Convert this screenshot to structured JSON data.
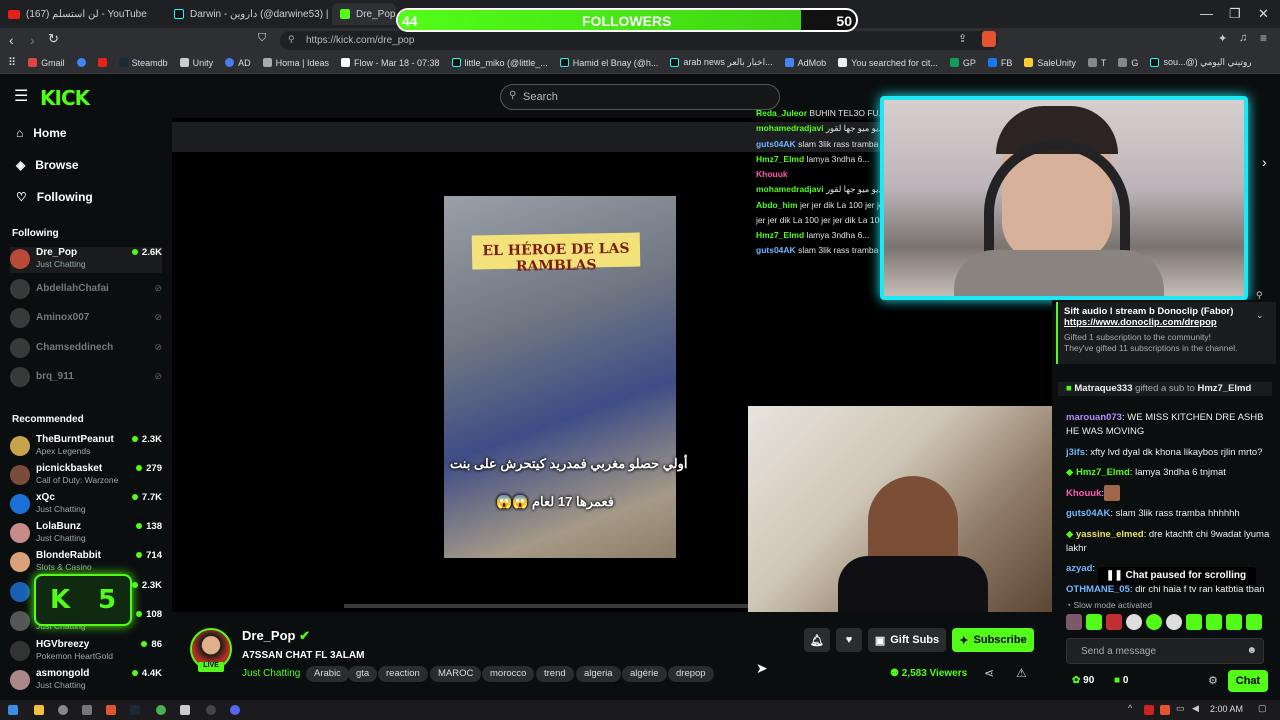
{
  "browser": {
    "tabs": [
      {
        "title": "(167) ‎لن استسلم‎ - YouTube",
        "icon": "youtube-icon"
      },
      {
        "title": "Darwin - ‎داروين (@darwine53) | TikTok",
        "icon": "tiktok-icon"
      },
      {
        "title": "Dre_Pop",
        "icon": "kick-icon"
      }
    ],
    "url": "https://kick.com/dre_pop",
    "bookmarks": [
      "Gmail",
      "Steamdb",
      "Unity",
      "AD",
      "Homa | Ideas",
      "Flow - Mar 18 - 07:38",
      "little_miko (@little_...",
      "Hamid el Bnay (@h...",
      "arab news ‎اخبار بالعر...",
      "AdMob",
      "You searched for cit...",
      "GP",
      "FB",
      "SaleUnity",
      "T",
      "G",
      "sou...@) ‎روتيني اليومي"
    ]
  },
  "kick": {
    "logo": "KICK",
    "search_placeholder": "Search",
    "nav": [
      {
        "label": "Home",
        "icon": "home-icon"
      },
      {
        "label": "Browse",
        "icon": "compass-icon"
      },
      {
        "label": "Following",
        "icon": "heart-icon"
      }
    ],
    "following_header": "Following",
    "following": [
      {
        "name": "Dre_Pop",
        "sub": "Just Chatting",
        "viewers": "2.6K",
        "live": true
      },
      {
        "name": "AbdellahChafai",
        "live": false
      },
      {
        "name": "Aminox007",
        "live": false
      },
      {
        "name": "Chamseddinech",
        "live": false
      },
      {
        "name": "brq_911",
        "live": false
      }
    ],
    "recommended_header": "Recommended",
    "recommended": [
      {
        "name": "TheBurntPeanut",
        "sub": "Apex Legends",
        "viewers": "2.3K"
      },
      {
        "name": "picnickbasket",
        "sub": "Call of Duty: Warzone",
        "viewers": "279"
      },
      {
        "name": "xQc",
        "sub": "Just Chatting",
        "viewers": "7.7K"
      },
      {
        "name": "LolaBunz",
        "sub": "Just Chatting",
        "viewers": "138"
      },
      {
        "name": "BlondeRabbit",
        "sub": "Slots & Casino",
        "viewers": "714"
      },
      {
        "name": "",
        "sub": "",
        "viewers": "2.3K"
      },
      {
        "name": "",
        "sub": "Just Chatting",
        "viewers": "108"
      },
      {
        "name": "HGVbreezy",
        "sub": "Pokemon HeartGold",
        "viewers": "86"
      },
      {
        "name": "asmongold",
        "sub": "Just Chatting",
        "viewers": "4.4K"
      }
    ]
  },
  "overlay": {
    "followers_label": "FOLLOWERS",
    "followers_current": "44",
    "followers_goal": "50",
    "followers_progress": 0.88,
    "k_badge_letter": "K",
    "k_badge_count": "5"
  },
  "video": {
    "banner": "EL HÉROE DE LAS RAMBLAS",
    "caption_1": "أولي حصلو مغربي فمدريد كيتحرش على بنت",
    "caption_2": "😱😱 فعمرها 17 لعام",
    "overlay_chat": [
      {
        "user": "Reda_Juleor",
        "text": "BUHIN TEL3O FU..."
      },
      {
        "user": "mohamedradjavi",
        "text": "‎ديو ميو جها لقور‎"
      },
      {
        "user": "guts04AK",
        "text": "slam 3lik rass tramba"
      },
      {
        "user": "Hmz7_Elmd",
        "text": "lamya 3ndha 6..."
      },
      {
        "user": "Khouuk",
        "text": ""
      },
      {
        "user": "mohamedradjavi",
        "text": "‎ديو ميو جها لقور‎"
      },
      {
        "user": "Abdo_him",
        "text": "jer jer dik La 100 jer jer"
      },
      {
        "user": "",
        "text": "jer jer dik La 100 jer jer dik La 100"
      },
      {
        "user": "Hmz7_Elmd",
        "text": "lamya 3ndha 6..."
      },
      {
        "user": "guts04AK",
        "text": "slam 3lik rass tramba"
      }
    ]
  },
  "stream": {
    "streamer": "Dre_Pop",
    "title": "A7SSAN CHAT FL 3ALAM",
    "category": "Just Chatting",
    "live_label": "LIVE",
    "tags": [
      "Arabic",
      "gta",
      "reaction",
      "MAROC",
      "morocco",
      "trend",
      "algeria",
      "algérie",
      "drepop"
    ],
    "gift_label": "Gift Subs",
    "subscribe_label": "Subscribe",
    "viewers": "2,583 Viewers"
  },
  "chat": {
    "pinned_title": "Sift audio l stream b Donoclip (Fabor)",
    "pinned_link": "https://www.donoclip.com/drepop",
    "gift_note_1": "Gifted 1 subscription to the community!",
    "gift_note_2": "They've gifted 11 subscriptions in the channel.",
    "gift_event": {
      "from": "Matraque333",
      "mid": "gifted a sub to",
      "to": "Hmz7_Elmd"
    },
    "messages": [
      {
        "user": "marouan073",
        "text": "WE MISS KITCHEN DRE ASHB HE WAS MOVING",
        "color": "#b58cff"
      },
      {
        "user": "j3ifs",
        "text": "xfty lvd dyal dk khona likaybos rjlin mrto?",
        "color": "#6fb6ff"
      },
      {
        "user": "Hmz7_Elmd",
        "text": "lamya 3ndha 6 tnjmat",
        "color": "#53fc18"
      },
      {
        "user": "Khouuk",
        "text": "",
        "color": "#ff5bb0"
      },
      {
        "user": "guts04AK",
        "text": "slam 3lik rass tramba hhhhhh",
        "color": "#6fb6ff"
      },
      {
        "user": "yassine_elmed",
        "text": "dre ktachft chi 9wadat lyuma lakhr",
        "color": "#e8e35a"
      },
      {
        "user": "azyad",
        "text": "",
        "color": "#6fb6ff"
      },
      {
        "user": "OTHMANE_05",
        "text": "dir chi haia f tv ran katbtia tban",
        "color": "#6fb6ff"
      }
    ],
    "paused_label": "Chat paused for scrolling",
    "slow_mode": "Slow mode activated",
    "input_placeholder": "Send a message",
    "points": "90",
    "subs": "0",
    "send_label": "Chat"
  },
  "taskbar": {
    "time": "2:00 AM"
  },
  "colors": {
    "kick_green": "#53fc18",
    "webcam_frame": "#1de9f4",
    "background": "#0b0e0f"
  }
}
